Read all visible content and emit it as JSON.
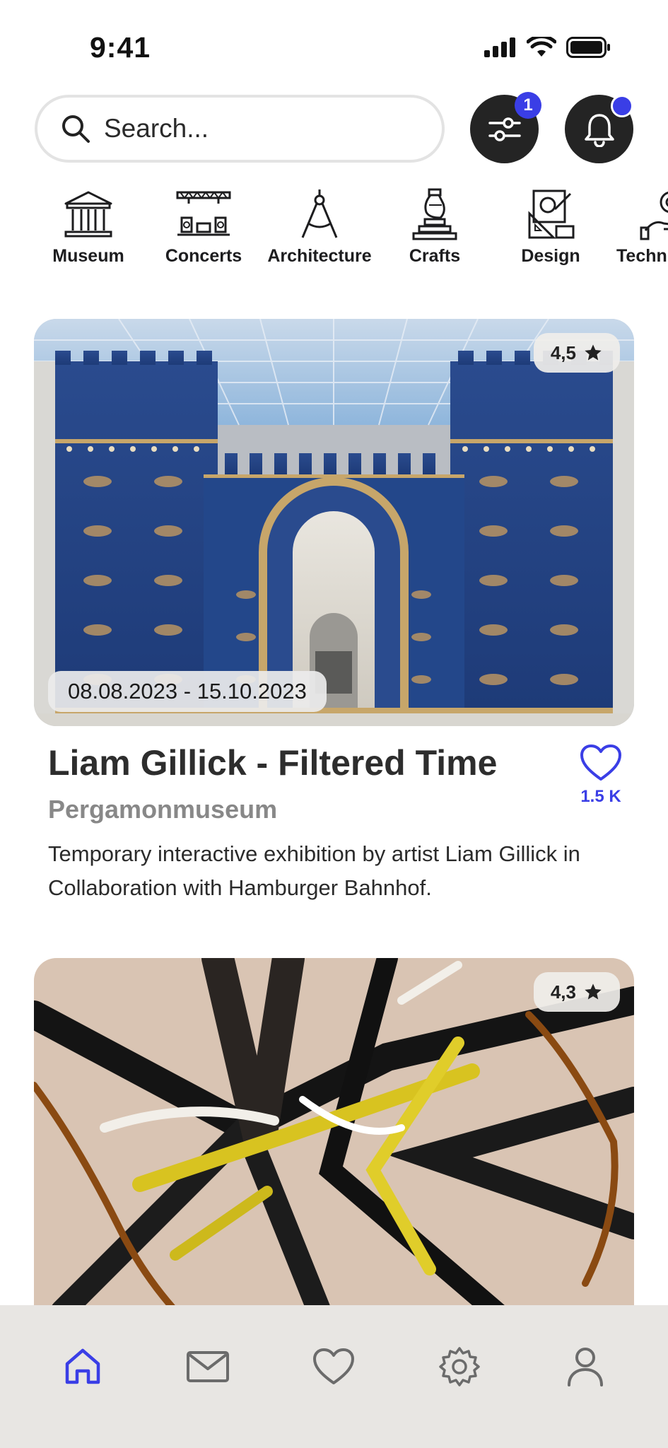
{
  "status_bar": {
    "time": "9:41",
    "icons": [
      "signal-icon",
      "wifi-icon",
      "battery-icon"
    ]
  },
  "search": {
    "placeholder": "Search...",
    "icon": "search-icon"
  },
  "filter_button": {
    "icon": "sliders-icon",
    "badge": "1"
  },
  "notification_button": {
    "icon": "bell-icon",
    "has_unread": true
  },
  "categories": [
    {
      "label": "Museum",
      "icon": "museum-icon"
    },
    {
      "label": "Concerts",
      "icon": "stage-icon"
    },
    {
      "label": "Architecture",
      "icon": "compass-icon"
    },
    {
      "label": "Crafts",
      "icon": "vase-icon"
    },
    {
      "label": "Design",
      "icon": "design-tools-icon"
    },
    {
      "label": "Techn",
      "icon": "tech-gear-icon"
    }
  ],
  "events": [
    {
      "rating": "4,5",
      "dates": "08.08.2023 - 15.10.2023",
      "title": "Liam Gillick - Filtered Time",
      "venue": "Pergamonmuseum",
      "description": "Temporary interactive exhibition by artist Liam Gillick in Collaboration with Hamburger Bahnhof.",
      "likes": "1.5 K",
      "image": "ishtar-gate-photo"
    },
    {
      "rating": "4,3",
      "image": "abstract-painting-photo"
    }
  ],
  "nav": {
    "items": [
      "home-icon",
      "mail-icon",
      "heart-icon",
      "settings-icon",
      "profile-icon"
    ],
    "active": "home-icon"
  },
  "colors": {
    "accent": "#3a3ee6",
    "dark": "#242424",
    "nav_bg": "#e8e6e3"
  }
}
